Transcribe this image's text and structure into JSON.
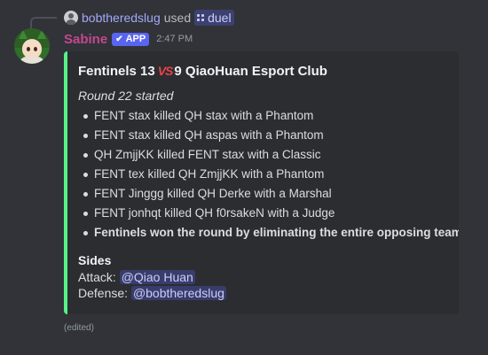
{
  "reply": {
    "username": "bobtheredslug",
    "used_text": "used",
    "command": "duel"
  },
  "message": {
    "author": "Sabine",
    "badge": "APP",
    "timestamp": "2:47 PM",
    "edited_label": "(edited)"
  },
  "embed": {
    "accent_color": "#57f287",
    "title_team1": "Fentinels",
    "score1": "13",
    "vs_label": "VS",
    "score2": "9",
    "title_team2": "QiaoHuan Esport Club",
    "round_text": "Round 22 started",
    "events": [
      "FENT stax killed QH stax with a Phantom",
      "FENT stax killed QH aspas with a Phantom",
      "QH ZmjjKK killed FENT stax with a Classic",
      "FENT tex killed QH ZmjjKK with a Phantom",
      "FENT Jinggg killed QH Derke with a Marshal",
      "FENT jonhqt killed QH f0rsakeN with a Judge"
    ],
    "result": "Fentinels won the round by eliminating the entire opposing team",
    "sides_title": "Sides",
    "attack_label": "Attack:",
    "attack_mention": "@Qiao Huan",
    "defense_label": "Defense:",
    "defense_mention": "@bobtheredslug"
  },
  "colors": {
    "background": "#313338",
    "embed_bg": "#2b2d31",
    "author_color": "#c54791",
    "badge_bg": "#5865f2",
    "vs_color": "#ed4245"
  }
}
